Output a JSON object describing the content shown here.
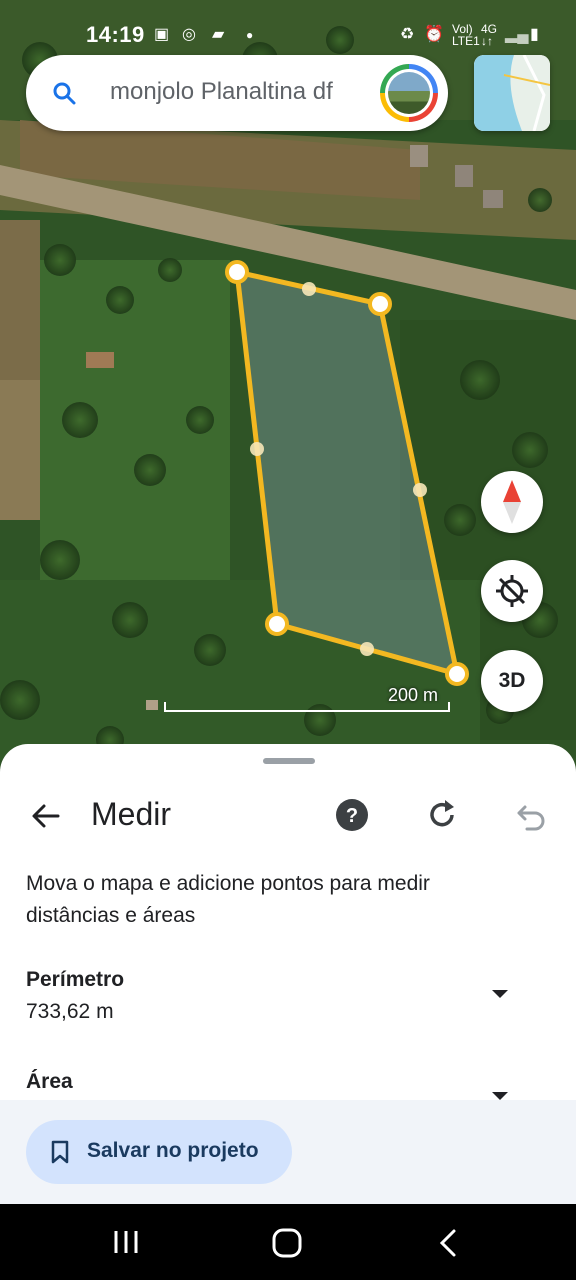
{
  "status_bar": {
    "time": "14:19",
    "network_top": "Vol)",
    "network_bottom": "LTE1",
    "net_type": "4G"
  },
  "search": {
    "text": "monjolo Planaltina df"
  },
  "map": {
    "scale_label": "200 m",
    "three_d_label": "3D",
    "polygon_fill": "#6e8a88",
    "polygon_stroke": "#f3b821"
  },
  "sheet": {
    "title": "Medir",
    "description": "Mova o mapa e adicione pontos para medir distâncias e áreas",
    "perimeter_label": "Perímetro",
    "perimeter_value": "733,62 m",
    "area_label": "Área",
    "save_button": "Salvar no projeto"
  },
  "icons": [
    "search-icon",
    "layers-thumbnail",
    "compass-icon",
    "location-off-icon",
    "back-arrow-icon",
    "help-icon",
    "refresh-icon",
    "undo-icon",
    "bookmark-icon",
    "nav-recents-icon",
    "nav-home-icon",
    "nav-back-icon"
  ]
}
